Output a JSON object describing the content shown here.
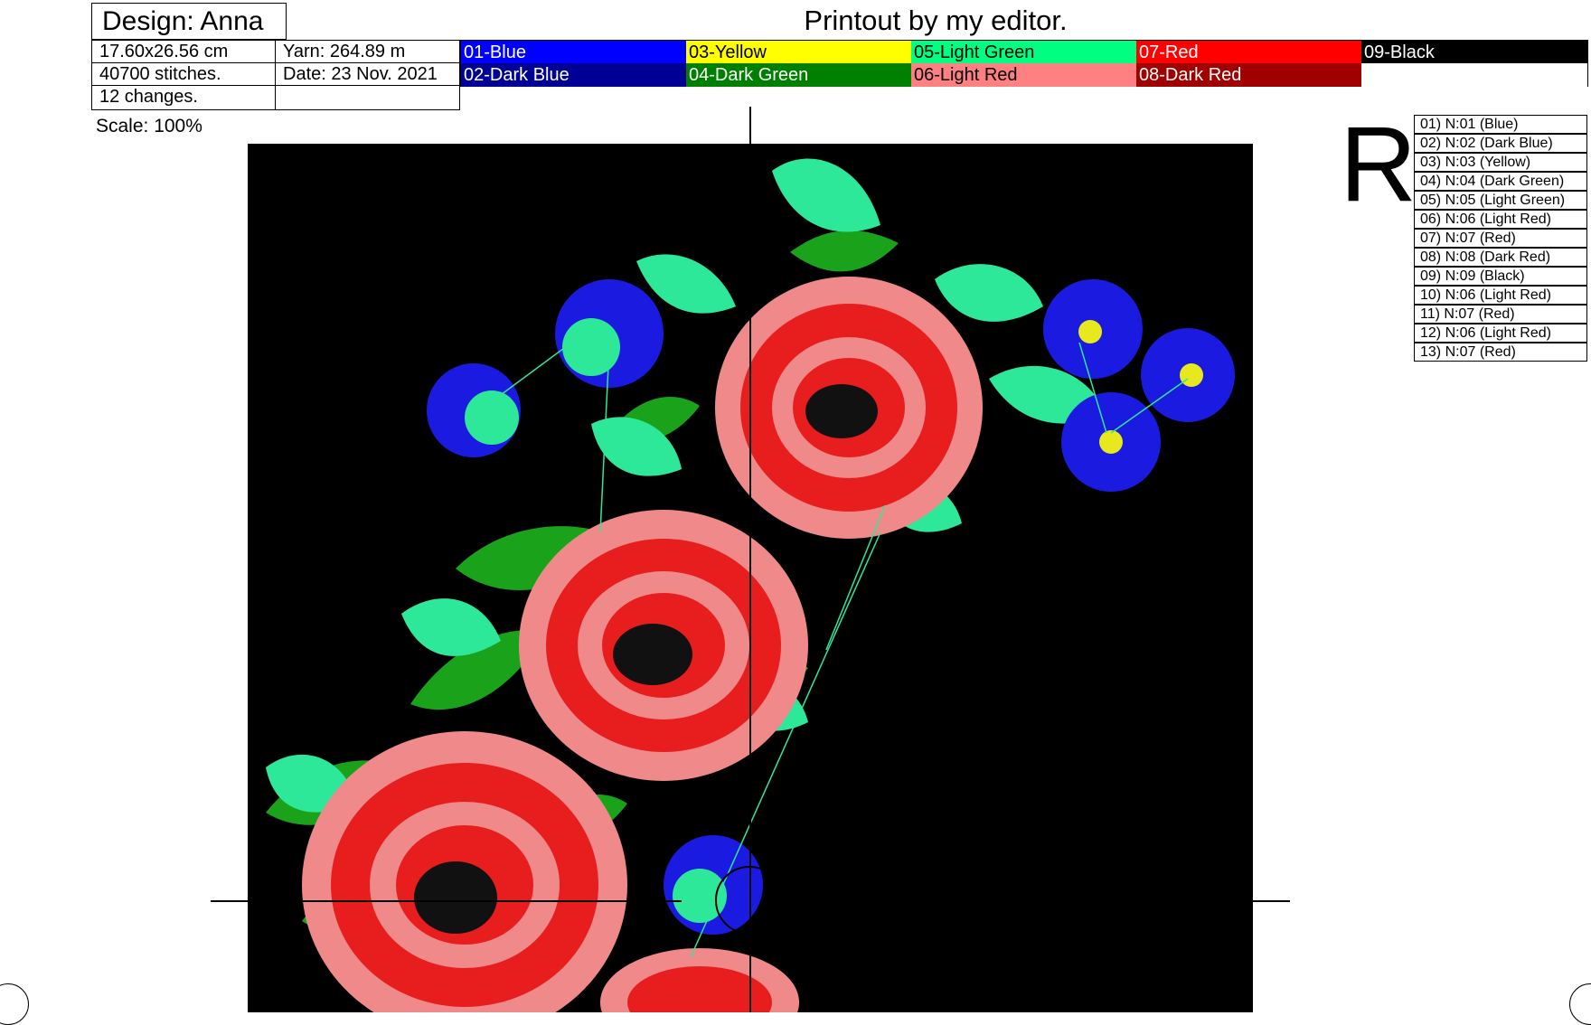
{
  "header": {
    "design_label": "Design: Anna",
    "printout_title": "Printout by my editor."
  },
  "info": {
    "size": "17.60x26.56 cm",
    "yarn": "Yarn: 264.89 m",
    "stitches": "40700 stitches.",
    "date": "Date: 23 Nov. 2021",
    "changes": "12 changes.",
    "empty": ""
  },
  "scale": "Scale: 100%",
  "palette": [
    {
      "label": "01-Blue",
      "color": "#0000ff",
      "text_color": "#ffffff"
    },
    {
      "label": "03-Yellow",
      "color": "#ffff00",
      "text_color": "#000000"
    },
    {
      "label": "05-Light Green",
      "color": "#00ff80",
      "text_color": "#000000"
    },
    {
      "label": "07-Red",
      "color": "#ff0000",
      "text_color": "#ffffff"
    },
    {
      "label": "09-Black",
      "color": "#000000",
      "text_color": "#ffffff"
    },
    {
      "label": "02-Dark Blue",
      "color": "#000096",
      "text_color": "#ffffff"
    },
    {
      "label": "04-Dark Green",
      "color": "#008000",
      "text_color": "#ffffff"
    },
    {
      "label": "06-Light Red",
      "color": "#ff8080",
      "text_color": "#000000"
    },
    {
      "label": "08-Dark Red",
      "color": "#a00000",
      "text_color": "#ffffff"
    },
    {
      "label": "",
      "color": "#ffffff",
      "text_color": "#000000"
    }
  ],
  "orientation_mark": "R",
  "sequence": [
    "01) N:01 (Blue)",
    "02) N:02 (Dark Blue)",
    "03) N:03 (Yellow)",
    "04) N:04 (Dark Green)",
    "05) N:05 (Light Green)",
    "06) N:06 (Light Red)",
    "07) N:07 (Red)",
    "08) N:08 (Dark Red)",
    "09) N:09 (Black)",
    "10) N:06 (Light Red)",
    "11) N:07 (Red)",
    "12) N:06 (Light Red)",
    "13) N:07 (Red)"
  ],
  "design_colors": {
    "background": "#000000",
    "leaf_light": "#2ee89a",
    "leaf_dark": "#1aa31a",
    "petal_light": "#f08a8a",
    "petal_red": "#e81e1e",
    "petal_dark": "#b00c0c",
    "cornflower": "#1a1ae0",
    "cornflower_dark": "#0a0a9a",
    "flower_center": "#e8e81e"
  }
}
